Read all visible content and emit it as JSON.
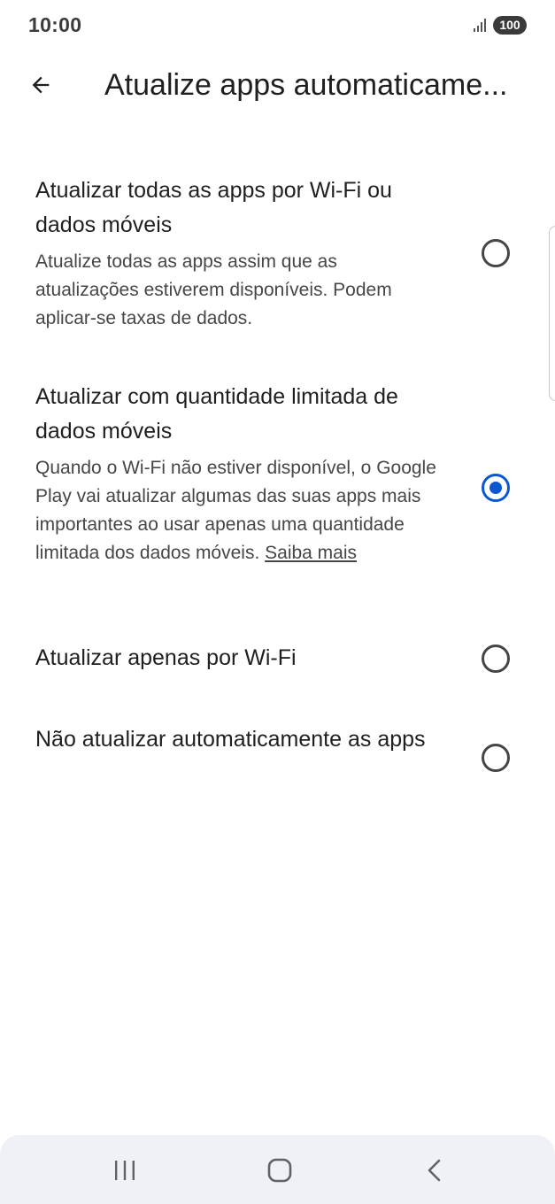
{
  "status_bar": {
    "time": "10:00",
    "signal_icon": "signal-bars-icon",
    "battery": "100"
  },
  "app_bar": {
    "back_icon": "arrow-back-icon",
    "title": "Atualize apps automaticame..."
  },
  "options": [
    {
      "title": "Atualizar todas as apps por Wi-Fi ou dados móveis",
      "description": "Atualize todas as apps assim que as atualizações estiverem disponíveis. Podem aplicar-se taxas de dados.",
      "selected": false
    },
    {
      "title": "Atualizar com quantidade limitada de dados móveis",
      "description": "Quando o Wi-Fi não estiver disponível, o Google Play vai atualizar algumas das suas apps mais importantes ao usar apenas uma quantidade limitada dos dados móveis.",
      "link": "Saiba mais",
      "selected": true
    },
    {
      "title": "Atualizar apenas por Wi-Fi",
      "selected": false
    },
    {
      "title": "Não atualizar automaticamente as apps",
      "selected": false
    }
  ],
  "colors": {
    "accent": "#0b57d0",
    "text_primary": "#1f1f1f",
    "text_secondary": "#444746",
    "nav_background": "#eff1f6"
  },
  "nav_bar": {
    "recents_icon": "recents-icon",
    "home_icon": "home-icon",
    "back_icon": "nav-back-icon"
  }
}
